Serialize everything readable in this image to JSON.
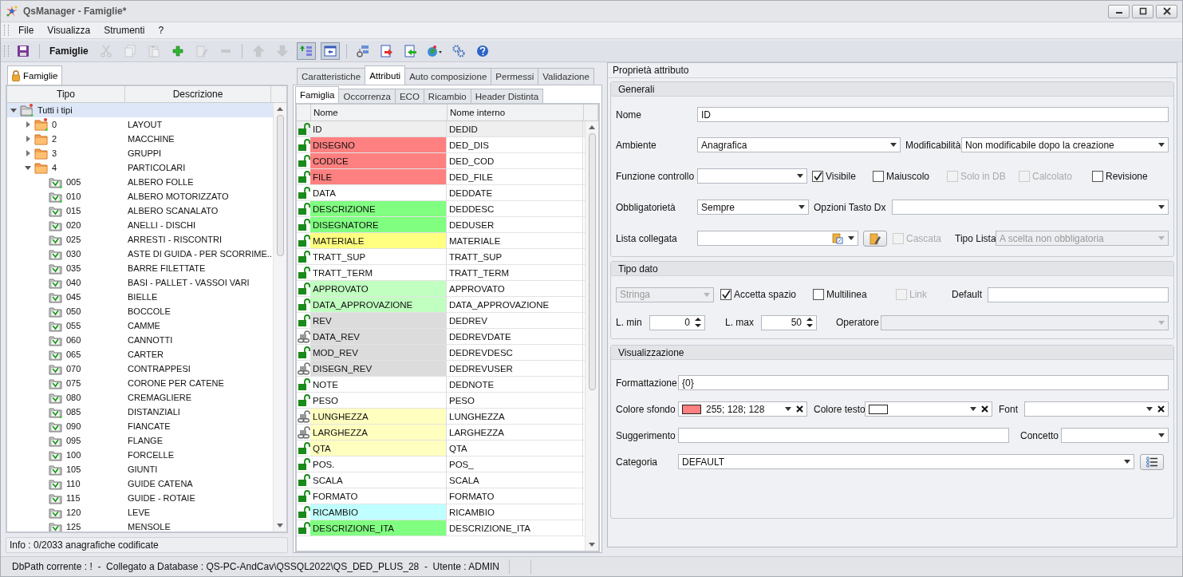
{
  "window": {
    "title": "QsManager - Famiglie*"
  },
  "menu": [
    "File",
    "Visualizza",
    "Strumenti",
    "?"
  ],
  "toolbar": [
    {
      "kind": "save",
      "disabled": false,
      "pressed": false
    },
    {
      "kind": "sep"
    },
    {
      "kind": "label",
      "text": "Famiglie"
    },
    {
      "kind": "cut",
      "disabled": true,
      "pressed": false
    },
    {
      "kind": "copy",
      "disabled": true,
      "pressed": false
    },
    {
      "kind": "paste",
      "disabled": true,
      "pressed": false
    },
    {
      "kind": "add",
      "disabled": false,
      "pressed": false
    },
    {
      "kind": "edit",
      "disabled": true,
      "pressed": false
    },
    {
      "kind": "remove",
      "disabled": true,
      "pressed": false
    },
    {
      "kind": "sep"
    },
    {
      "kind": "up",
      "disabled": true,
      "pressed": false
    },
    {
      "kind": "down",
      "disabled": true,
      "pressed": false
    },
    {
      "kind": "promote",
      "disabled": false,
      "pressed": true
    },
    {
      "kind": "panel",
      "disabled": false,
      "pressed": true
    },
    {
      "kind": "sep"
    },
    {
      "kind": "hierarchy",
      "disabled": false,
      "pressed": false
    },
    {
      "kind": "export",
      "disabled": false,
      "pressed": false
    },
    {
      "kind": "import",
      "disabled": false,
      "pressed": false
    },
    {
      "kind": "globe",
      "disabled": false,
      "pressed": false
    },
    {
      "kind": "gears",
      "disabled": false,
      "pressed": false
    },
    {
      "kind": "help",
      "disabled": false,
      "pressed": false
    }
  ],
  "left_panel": {
    "tabs": [
      {
        "label": "Famiglie",
        "selected": true
      }
    ],
    "columns": [
      "Tipo",
      "Descrizione"
    ],
    "tree": [
      {
        "code": "Tutti i tipi",
        "kind": "root",
        "new": true,
        "expanded": true,
        "selected": true,
        "children": [
          {
            "code": "0",
            "description": "LAYOUT",
            "kind": "folder",
            "new": true,
            "expanded": false,
            "selected": false
          },
          {
            "code": "2",
            "description": "MACCHINE",
            "kind": "folder",
            "new": false,
            "expanded": false,
            "selected": false
          },
          {
            "code": "3",
            "description": "GRUPPI",
            "kind": "folder",
            "new": false,
            "expanded": false,
            "selected": false
          },
          {
            "code": "4",
            "description": "PARTICOLARI",
            "kind": "folder",
            "new": false,
            "expanded": true,
            "selected": false,
            "children": [
              {
                "code": "005",
                "description": "ALBERO FOLLE",
                "kind": "family",
                "new": true,
                "selected": false
              },
              {
                "code": "010",
                "description": "ALBERO MOTORIZZATO",
                "kind": "family",
                "new": true,
                "selected": false
              },
              {
                "code": "015",
                "description": "ALBERO SCANALATO",
                "kind": "family",
                "new": false,
                "selected": false
              },
              {
                "code": "020",
                "description": "ANELLI - DISCHI",
                "kind": "family",
                "new": false,
                "selected": false
              },
              {
                "code": "025",
                "description": "ARRESTI - RISCONTRI",
                "kind": "family",
                "new": false,
                "selected": false
              },
              {
                "code": "030",
                "description": "ASTE DI GUIDA - PER SCORRIME...",
                "kind": "family",
                "new": false,
                "selected": false
              },
              {
                "code": "035",
                "description": "BARRE FILETTATE",
                "kind": "family",
                "new": false,
                "selected": false
              },
              {
                "code": "040",
                "description": "BASI - PALLET - VASSOI VARI",
                "kind": "family",
                "new": false,
                "selected": false
              },
              {
                "code": "045",
                "description": "BIELLE",
                "kind": "family",
                "new": false,
                "selected": false
              },
              {
                "code": "050",
                "description": "BOCCOLE",
                "kind": "family",
                "new": false,
                "selected": false
              },
              {
                "code": "055",
                "description": "CAMME",
                "kind": "family",
                "new": false,
                "selected": false
              },
              {
                "code": "060",
                "description": "CANNOTTI",
                "kind": "family",
                "new": false,
                "selected": false
              },
              {
                "code": "065",
                "description": "CARTER",
                "kind": "family",
                "new": false,
                "selected": false
              },
              {
                "code": "070",
                "description": "CONTRAPPESI",
                "kind": "family",
                "new": false,
                "selected": false
              },
              {
                "code": "075",
                "description": "CORONE PER CATENE",
                "kind": "family",
                "new": false,
                "selected": false
              },
              {
                "code": "080",
                "description": "CREMAGLIERE",
                "kind": "family",
                "new": false,
                "selected": false
              },
              {
                "code": "085",
                "description": "DISTANZIALI",
                "kind": "family",
                "new": true,
                "selected": false
              },
              {
                "code": "090",
                "description": "FIANCATE",
                "kind": "family",
                "new": false,
                "selected": false
              },
              {
                "code": "095",
                "description": "FLANGE",
                "kind": "family",
                "new": false,
                "selected": false
              },
              {
                "code": "100",
                "description": "FORCELLE",
                "kind": "family",
                "new": false,
                "selected": false
              },
              {
                "code": "105",
                "description": "GIUNTI",
                "kind": "family",
                "new": false,
                "selected": false
              },
              {
                "code": "110",
                "description": "GUIDE CATENA",
                "kind": "family",
                "new": false,
                "selected": false
              },
              {
                "code": "115",
                "description": "GUIDE - ROTAIE",
                "kind": "family",
                "new": false,
                "selected": false
              },
              {
                "code": "120",
                "description": "LEVE",
                "kind": "family",
                "new": false,
                "selected": false
              },
              {
                "code": "125",
                "description": "MENSOLE",
                "kind": "family",
                "new": false,
                "selected": false
              }
            ]
          }
        ]
      }
    ],
    "info": "Info : 0/2033 anagrafiche codificate"
  },
  "tabs": [
    {
      "label": "Caratteristiche",
      "selected": false
    },
    {
      "label": "Attributi",
      "selected": true
    },
    {
      "label": "Auto composizione",
      "selected": false
    },
    {
      "label": "Permessi",
      "selected": false
    },
    {
      "label": "Validazione",
      "selected": false
    }
  ],
  "sub_tabs": [
    {
      "label": "Famiglia",
      "selected": true
    },
    {
      "label": "Occorrenza",
      "selected": false
    },
    {
      "label": "ECO",
      "selected": false
    },
    {
      "label": "Ricambio",
      "selected": false
    },
    {
      "label": "Header Distinta",
      "selected": false
    }
  ],
  "attributes": {
    "columns": [
      "Nome",
      "Nome interno"
    ],
    "rows": [
      {
        "kind": "lock",
        "name": "ID",
        "internal": "DEDID",
        "selected": true
      },
      {
        "kind": "lock",
        "name": "DISEGNO",
        "internal": "DED_DIS",
        "color": "#ff8080",
        "selected": false
      },
      {
        "kind": "lock",
        "name": "CODICE",
        "internal": "DED_COD",
        "color": "#ff8080",
        "selected": false
      },
      {
        "kind": "lock",
        "name": "FILE",
        "internal": "DED_FILE",
        "color": "#ff8080",
        "selected": false
      },
      {
        "kind": "lock",
        "name": "DATA",
        "internal": "DEDDATE",
        "selected": false
      },
      {
        "kind": "lock",
        "name": "DESCRIZIONE",
        "internal": "DEDDESC",
        "color": "#80ff80",
        "selected": false
      },
      {
        "kind": "lock",
        "name": "DISEGNATORE",
        "internal": "DEDUSER",
        "color": "#80ff80",
        "selected": false
      },
      {
        "kind": "lock",
        "name": "MATERIALE",
        "internal": "MATERIALE",
        "color": "#ffff80",
        "selected": false
      },
      {
        "kind": "lock",
        "name": "TRATT_SUP",
        "internal": "TRATT_SUP",
        "selected": false
      },
      {
        "kind": "lock",
        "name": "TRATT_TERM",
        "internal": "TRATT_TERM",
        "selected": false
      },
      {
        "kind": "lock",
        "name": "APPROVATO",
        "internal": "APPROVATO",
        "color": "#c0ffc0",
        "selected": false
      },
      {
        "kind": "lock",
        "name": "DATA_APPROVAZIONE",
        "internal": "DATA_APPROVAZIONE",
        "color": "#c0ffc0",
        "selected": false
      },
      {
        "kind": "lock",
        "name": "REV",
        "internal": "DEDREV",
        "color": "#dcdcdc",
        "selected": false
      },
      {
        "kind": "link",
        "name": "DATA_REV",
        "internal": "DEDREVDATE",
        "color": "#dcdcdc",
        "selected": false
      },
      {
        "kind": "lock",
        "name": "MOD_REV",
        "internal": "DEDREVDESC",
        "color": "#dcdcdc",
        "selected": false
      },
      {
        "kind": "link",
        "name": "DISEGN_REV",
        "internal": "DEDREVUSER",
        "color": "#dcdcdc",
        "selected": false
      },
      {
        "kind": "lock",
        "name": "NOTE",
        "internal": "DEDNOTE",
        "selected": false
      },
      {
        "kind": "lock",
        "name": "PESO",
        "internal": "PESO",
        "selected": false
      },
      {
        "kind": "link",
        "name": "LUNGHEZZA",
        "internal": "LUNGHEZZA",
        "color": "#ffffc0",
        "selected": false
      },
      {
        "kind": "link",
        "name": "LARGHEZZA",
        "internal": "LARGHEZZA",
        "color": "#ffffc0",
        "selected": false
      },
      {
        "kind": "lock",
        "name": "QTA",
        "internal": "QTA",
        "color": "#ffffc0",
        "selected": false
      },
      {
        "kind": "lock",
        "name": "POS.",
        "internal": "POS_",
        "selected": false
      },
      {
        "kind": "lock",
        "name": "SCALA",
        "internal": "SCALA",
        "selected": false
      },
      {
        "kind": "lock",
        "name": "FORMATO",
        "internal": "FORMATO",
        "selected": false
      },
      {
        "kind": "lock",
        "name": "RICAMBIO",
        "internal": "RICAMBIO",
        "color": "#c0ffff",
        "selected": false
      },
      {
        "kind": "lock",
        "name": "DESCRIZIONE_ITA",
        "internal": "DESCRIZIONE_ITA",
        "color": "#80ff80",
        "selected": false
      }
    ]
  },
  "properties": {
    "title": "Proprietà attributo",
    "groups": [
      {
        "title": "Generali",
        "lines": [
          {
            "fields": [
              {
                "kind": "label",
                "text": "Nome"
              },
              {
                "kind": "text",
                "value": "ID"
              }
            ]
          },
          {
            "fields": [
              {
                "kind": "label",
                "text": "Ambiente"
              },
              {
                "kind": "combo",
                "value": "Anagrafica",
                "disabled": false
              },
              {
                "kind": "label",
                "text": "Modificabilità"
              },
              {
                "kind": "combo",
                "value": "Non modificabile dopo la creazione",
                "disabled": false
              }
            ]
          },
          {
            "fields": [
              {
                "kind": "label",
                "text": "Funzione controllo"
              },
              {
                "kind": "combo",
                "disabled": false
              },
              {
                "kind": "check",
                "text": "Visibile",
                "checked": true,
                "disabled": false
              },
              {
                "kind": "check",
                "text": "Maiuscolo",
                "checked": false,
                "disabled": false
              },
              {
                "kind": "check",
                "text": "Solo in DB",
                "checked": false,
                "disabled": true
              },
              {
                "kind": "check",
                "text": "Calcolato",
                "checked": false,
                "disabled": true
              },
              {
                "kind": "check",
                "text": "Revisione",
                "checked": false,
                "disabled": false
              }
            ]
          },
          {
            "fields": [
              {
                "kind": "label",
                "text": "Obbligatorietà"
              },
              {
                "kind": "combo",
                "value": "Sempre",
                "disabled": false
              },
              {
                "kind": "label",
                "text": "Opzioni Tasto Dx"
              },
              {
                "kind": "combo",
                "disabled": false
              }
            ]
          },
          {
            "fields": [
              {
                "kind": "label",
                "text": "Lista collegata"
              },
              {
                "kind": "listcombo",
                "disabled": false
              },
              {
                "kind": "editbutton"
              },
              {
                "kind": "check",
                "text": "Cascata",
                "checked": false,
                "disabled": true
              },
              {
                "kind": "label",
                "text": "Tipo Lista"
              },
              {
                "kind": "combo",
                "value": "A scelta non obbligatoria",
                "disabled": true
              }
            ]
          }
        ]
      },
      {
        "title": "Tipo dato",
        "lines": [
          {
            "fields": [
              {
                "kind": "combo",
                "value": "Stringa",
                "disabled": true
              },
              {
                "kind": "check",
                "text": "Accetta spazio",
                "checked": true,
                "disabled": false
              },
              {
                "kind": "check",
                "text": "Multilinea",
                "checked": false,
                "disabled": false
              },
              {
                "kind": "check",
                "text": "Link",
                "checked": false,
                "disabled": true
              },
              {
                "kind": "label",
                "text": "Default"
              },
              {
                "kind": "text"
              }
            ]
          },
          {
            "fields": [
              {
                "kind": "label",
                "text": "L. min"
              },
              {
                "kind": "spin",
                "value": "0"
              },
              {
                "kind": "label",
                "text": "L. max"
              },
              {
                "kind": "spin",
                "value": "50"
              },
              {
                "kind": "label",
                "text": "Operatore"
              },
              {
                "kind": "combo",
                "disabled": true
              }
            ]
          }
        ]
      },
      {
        "title": "Visualizzazione",
        "lines": [
          {
            "fields": [
              {
                "kind": "label",
                "text": "Formattazione"
              },
              {
                "kind": "text",
                "value": "{0}"
              }
            ]
          },
          {
            "fields": [
              {
                "kind": "label",
                "text": "Colore sfondo"
              },
              {
                "kind": "colorpick",
                "color": "#ff8080",
                "value": "255; 128; 128"
              },
              {
                "kind": "label",
                "text": "Colore testo"
              },
              {
                "kind": "colorpick",
                "color": "#ffffff"
              },
              {
                "kind": "label",
                "text": "Font"
              },
              {
                "kind": "clearcombo"
              }
            ]
          },
          {
            "fields": [
              {
                "kind": "label",
                "text": "Suggerimento"
              },
              {
                "kind": "text"
              },
              {
                "kind": "label",
                "text": "Concetto"
              },
              {
                "kind": "combo",
                "disabled": false
              }
            ]
          },
          {
            "fields": [
              {
                "kind": "label",
                "text": "Categoria"
              },
              {
                "kind": "combo",
                "value": "DEFAULT",
                "disabled": false
              },
              {
                "kind": "listbutton"
              }
            ]
          }
        ]
      }
    ]
  },
  "status_bar": "DbPath corrente : !  -  Collegato a Database : QS-PC-AndCav\\QSSQL2022\\QS_DED_PLUS_28  -  Utente : ADMIN"
}
